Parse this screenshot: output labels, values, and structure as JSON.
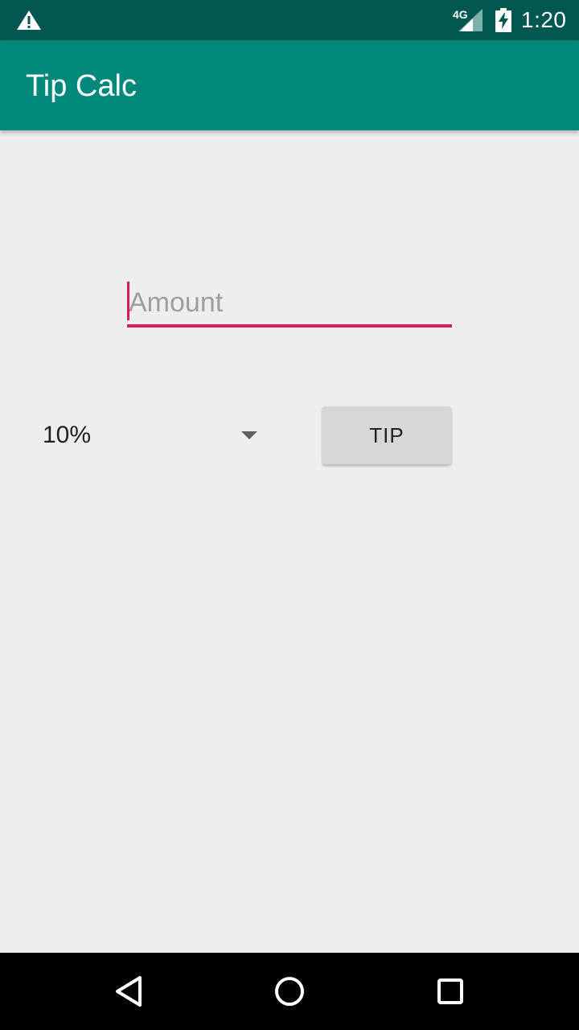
{
  "status_bar": {
    "network": "4G",
    "time": "1:20",
    "icons": [
      "warning-icon",
      "signal-icon",
      "battery-charging-icon"
    ]
  },
  "app_bar": {
    "title": "Tip Calc"
  },
  "form": {
    "amount_placeholder": "Amount",
    "amount_value": "",
    "tip_percent_selected": "10%",
    "tip_button_label": "TIP"
  },
  "nav_bar": {
    "icons": [
      "back-icon",
      "home-icon",
      "recents-icon"
    ]
  },
  "colors": {
    "status_bar": "#00574f",
    "app_bar": "#00887a",
    "accent": "#d81b60",
    "background": "#eeeeee"
  }
}
